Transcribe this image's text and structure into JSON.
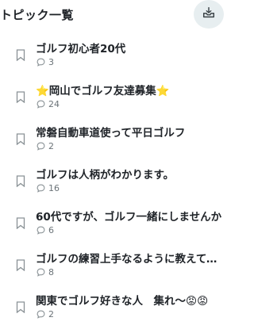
{
  "header": {
    "title": "トピック一覧"
  },
  "topics": [
    {
      "title": "ゴルフ初心者20代",
      "comments": "3"
    },
    {
      "title": "⭐岡山でゴルフ友達募集⭐",
      "comments": "24"
    },
    {
      "title": "常磐自動車道使って平日ゴルフ",
      "comments": "2"
    },
    {
      "title": "ゴルフは人柄がわかります。",
      "comments": "16"
    },
    {
      "title": "60代ですが、ゴルフ一緒にしませんか",
      "comments": "6"
    },
    {
      "title": "ゴルフの練習上手なるように教えてくださ",
      "comments": "8"
    },
    {
      "title": "関東でゴルフ好きな人　集れ〜😡😡",
      "comments": "2"
    }
  ]
}
